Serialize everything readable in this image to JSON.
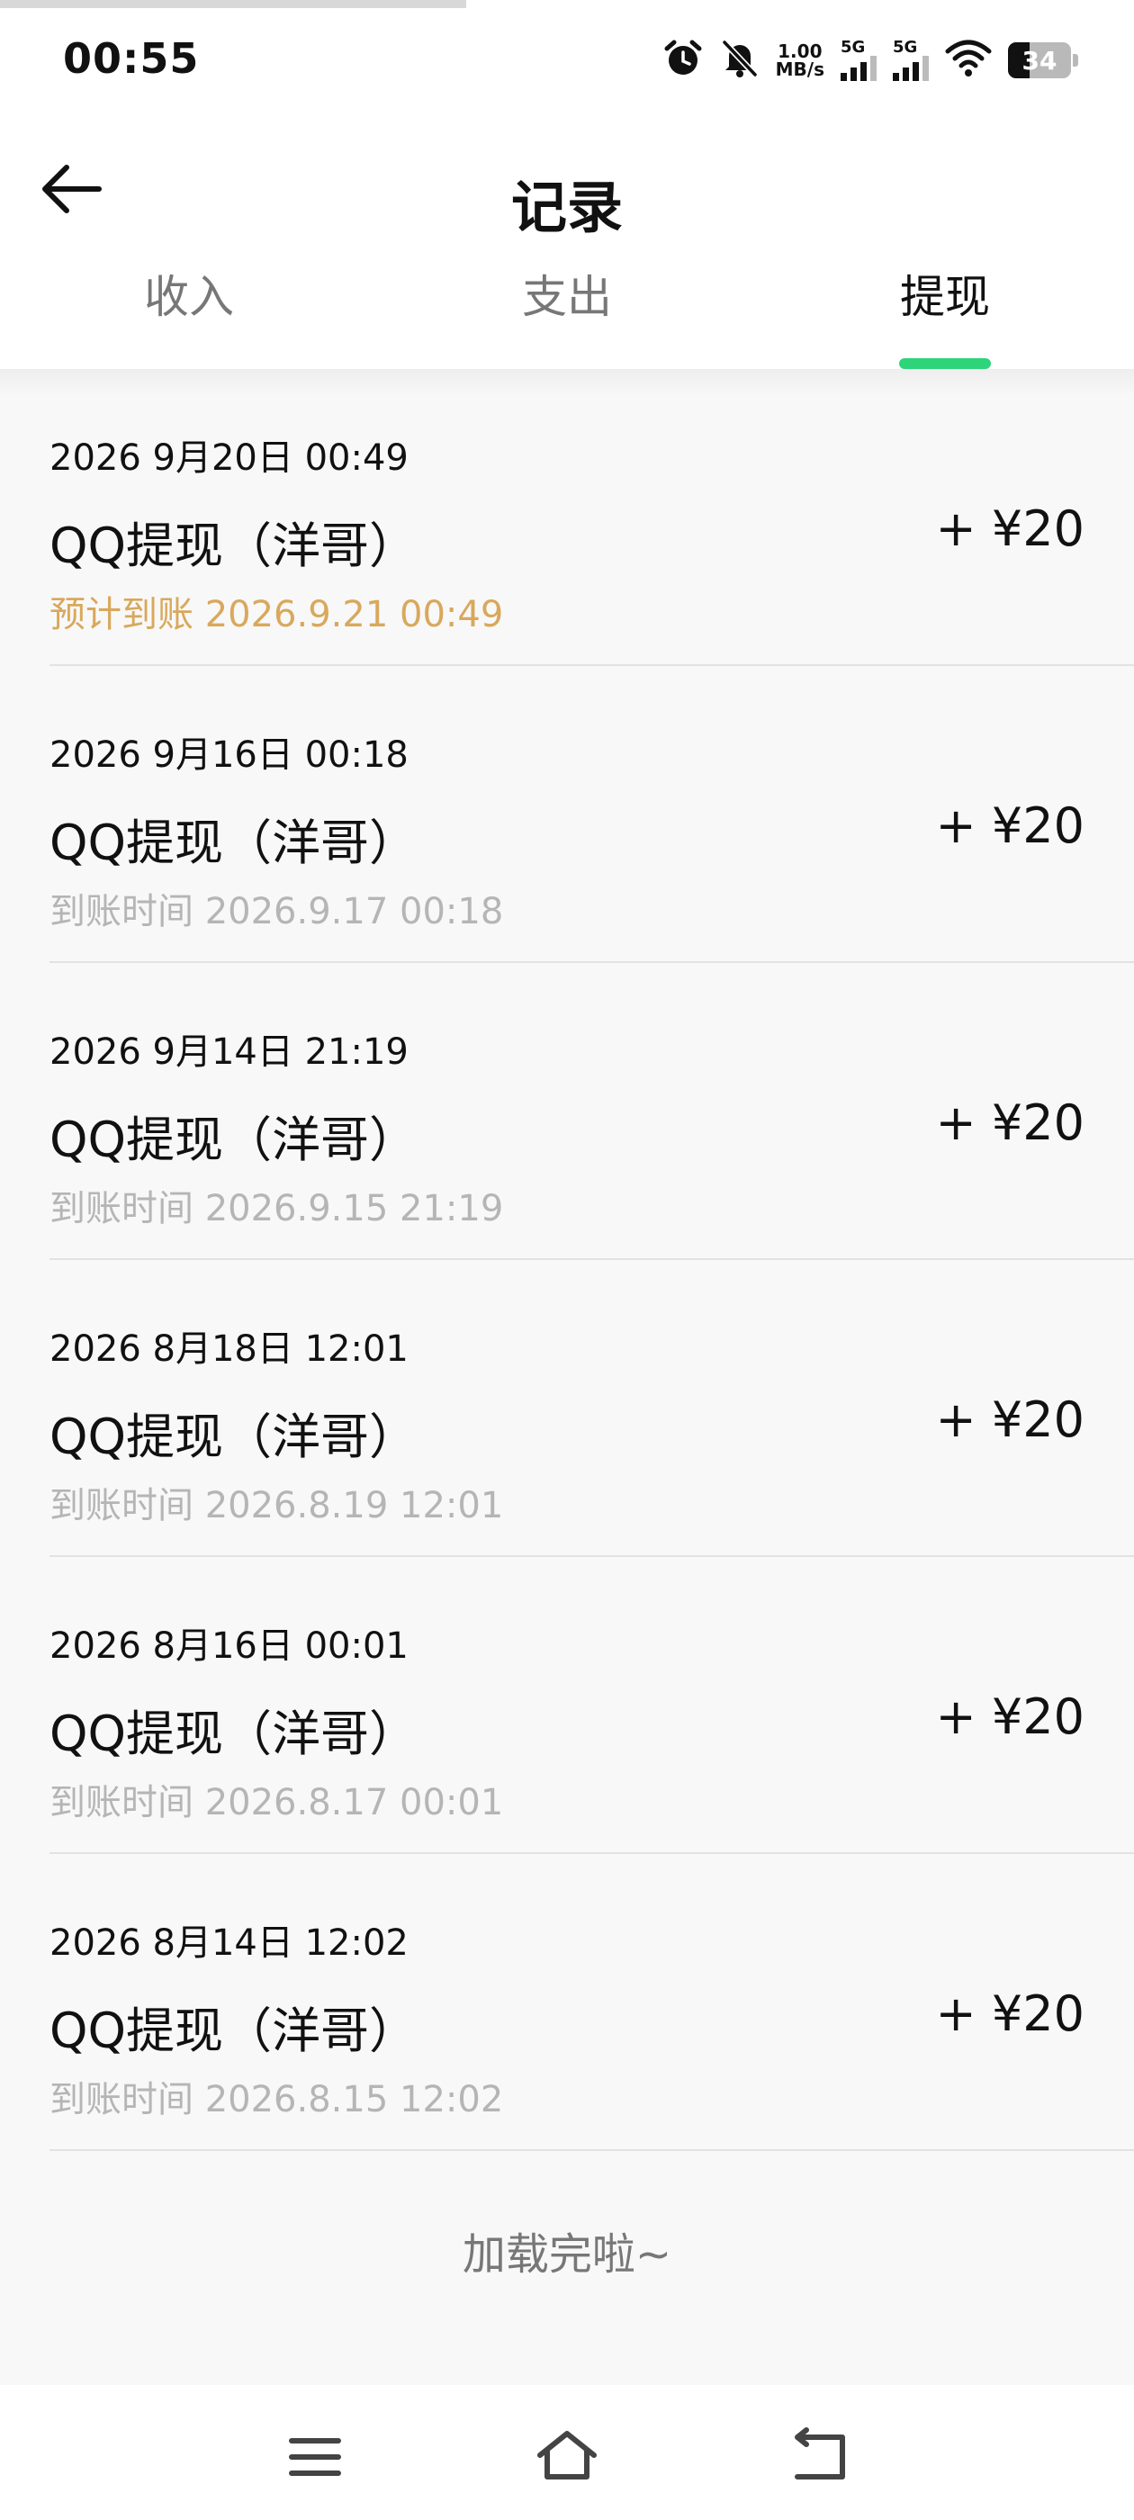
{
  "status_bar": {
    "time": "00:55",
    "net_speed_value": "1.00",
    "net_speed_unit": "MB/s",
    "sim1_label": "5G",
    "sim2_label": "5G",
    "battery_level": "34",
    "icons": [
      "alarm-icon",
      "mute-icon",
      "wifi-icon",
      "battery-icon"
    ]
  },
  "header": {
    "title": "记录"
  },
  "tabs": [
    {
      "label": "收入"
    },
    {
      "label": "支出"
    },
    {
      "label": "提现"
    }
  ],
  "active_tab_index": 2,
  "accent_color": "#2ed47a",
  "pending_color": "#d9a85c",
  "records": [
    {
      "date": "2026 9月20日 00:49",
      "name": "QQ提现（洋哥）",
      "arrival": "预计到账 2026.9.21 00:49",
      "amount": "+ ¥20",
      "pending": true
    },
    {
      "date": "2026 9月16日 00:18",
      "name": "QQ提现（洋哥）",
      "arrival": "到账时间 2026.9.17 00:18",
      "amount": "+ ¥20",
      "pending": false
    },
    {
      "date": "2026 9月14日 21:19",
      "name": "QQ提现（洋哥）",
      "arrival": "到账时间 2026.9.15 21:19",
      "amount": "+ ¥20",
      "pending": false
    },
    {
      "date": "2026 8月18日 12:01",
      "name": "QQ提现（洋哥）",
      "arrival": "到账时间 2026.8.19 12:01",
      "amount": "+ ¥20",
      "pending": false
    },
    {
      "date": "2026 8月16日 00:01",
      "name": "QQ提现（洋哥）",
      "arrival": "到账时间 2026.8.17 00:01",
      "amount": "+ ¥20",
      "pending": false
    },
    {
      "date": "2026 8月14日 12:02",
      "name": "QQ提现（洋哥）",
      "arrival": "到账时间 2026.8.15 12:02",
      "amount": "+ ¥20",
      "pending": false
    }
  ],
  "footer_text": "加载完啦~",
  "nav_bar": {
    "icons": [
      "menu-icon",
      "home-icon",
      "back-nav-icon"
    ]
  }
}
